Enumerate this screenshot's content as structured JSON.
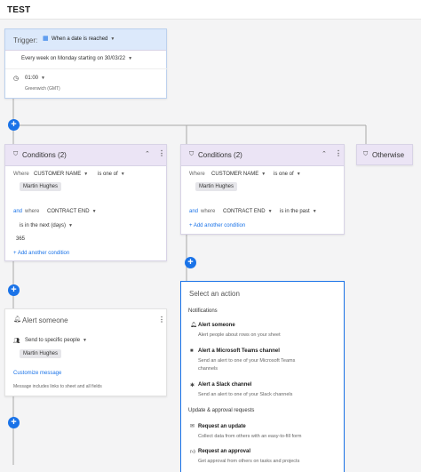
{
  "app": {
    "title": "TEST"
  },
  "trigger": {
    "label": "Trigger:",
    "when_label": "When a date is reached",
    "schedule": "Every week on Monday starting on 30/03/22",
    "time": "01:00",
    "timezone": "Greenwich (GMT)"
  },
  "conditions_left": {
    "title": "Conditions (2)",
    "where": "Where",
    "field1": "CUSTOMER NAME",
    "op1": "is one of",
    "value1": "Martin Hughes",
    "and": "and",
    "where2": "where",
    "field2": "CONTRACT END",
    "op2": "is in the next (days)",
    "value2": "365",
    "add": "Add another condition"
  },
  "conditions_mid": {
    "title": "Conditions (2)",
    "where": "Where",
    "field1": "CUSTOMER NAME",
    "op1": "is one of",
    "value1": "Martin Hughes",
    "and": "and",
    "where2": "where",
    "field2": "CONTRACT END",
    "op2": "is in the past",
    "add": "Add another condition"
  },
  "otherwise": {
    "label": "Otherwise"
  },
  "alert": {
    "title": "Alert someone",
    "send_to": "Send to specific people",
    "person": "Martin Hughes",
    "customize": "Customize message",
    "note": "Message includes links to sheet and all fields"
  },
  "action_panel": {
    "title": "Select an action",
    "section_notifications": "Notifications",
    "items": [
      {
        "title": "Alert someone",
        "desc": "Alert people about rows on your sheet"
      },
      {
        "title": "Alert a Microsoft Teams channel",
        "desc1": "Send an alert to one of your Microsoft Teams",
        "desc2": "channels"
      },
      {
        "title": "Alert a Slack channel",
        "desc": "Send an alert to one of your Slack channels"
      }
    ],
    "section_updates": "Update & approval requests",
    "updates": [
      {
        "title": "Request an update",
        "desc": "Collect data from others with an easy-to-fill form"
      },
      {
        "title": "Request an approval",
        "desc": "Get approval from others on tasks and projects"
      }
    ]
  },
  "plus_symbol": "+",
  "colors": {
    "accent": "#1a73e8",
    "condition_header": "#ebe4f5",
    "trigger_header": "#dce9fb"
  }
}
